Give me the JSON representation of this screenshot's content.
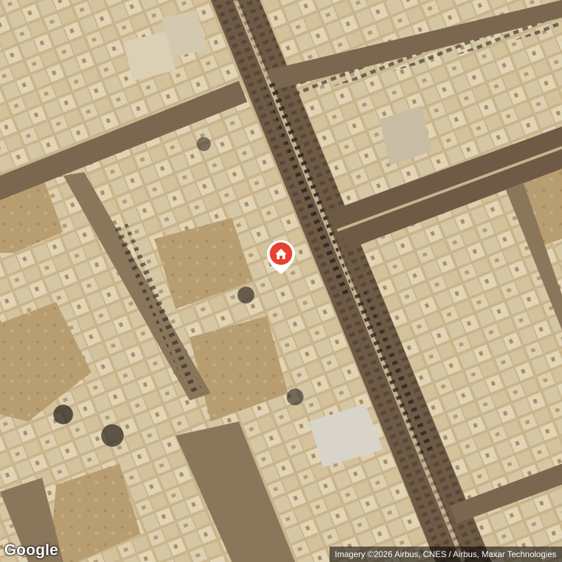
{
  "map": {
    "view": "satellite",
    "colors": {
      "ground": "#b9a27a",
      "roof": "#d9c9a6",
      "road": "#6e5a45",
      "marker": "#e8412c"
    },
    "marker": {
      "icon": "house-icon"
    },
    "logo": "Google",
    "attribution": "Imagery ©2026 Airbus, CNES / Airbus, Maxar Technologies"
  }
}
